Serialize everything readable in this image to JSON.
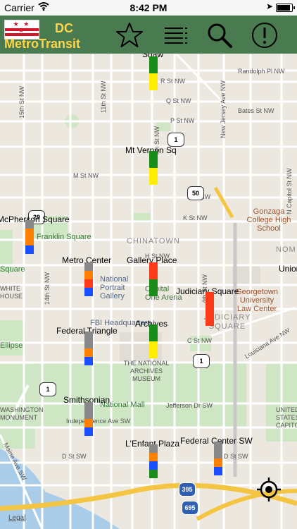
{
  "status": {
    "carrier": "Carrier",
    "time": "8:42 PM"
  },
  "header": {
    "title_line1": "DC",
    "title_line2": "MetroTransit"
  },
  "icons": {
    "favorites": "star-icon",
    "list": "list-icon",
    "search": "search-icon",
    "alerts": "exclamation-icon",
    "locate": "locate-icon"
  },
  "map": {
    "legal": "Legal",
    "streets": {
      "randolph": "Randolph Pl NW",
      "r_st": "R St NW",
      "q_st": "Q St NW",
      "bates": "Bates St NW",
      "p_st": "P St NW",
      "m_st": "M St NW",
      "l_st": "L St NW",
      "k_st": "K St NW",
      "h_st": "H St NW",
      "c_st": "C St NW",
      "jefferson": "Jefferson Dr SW",
      "independence": "Independence Ave SW",
      "d_st_sw": "D St SW",
      "d_st_sw2": "D St SW",
      "louisiana": "Louisiana Ave NW",
      "nj_ave": "New Jersey Ave NW",
      "n_capitol": "N Capitol St NW",
      "fourth": "4th St NW",
      "seventh": "7th St NW",
      "eleventh": "11th St NW",
      "fourteenth": "14th St NW",
      "fifteenth": "15th St NW",
      "maine": "Maine Ave SW"
    },
    "pois": {
      "gonzaga": "Gonzaga College High School",
      "franklin": "Franklin Square",
      "national_gallery": "National Portrait Gallery",
      "capital_one": "Capital One Arena",
      "georgetown": "Georgetown University Law Center",
      "fbi": "FBI Headquarters",
      "archives_museum": "THE NATIONAL ARCHIVES MUSEUM",
      "national_mall": "National Mall",
      "washington_monument": "WASHINGTON MONUMENT",
      "us_capitol": "UNITED STATES CAPITOL",
      "ellipse": "Ellipse",
      "union": "Union",
      "white_house": "WHITE HOUSE",
      "square": "Square"
    },
    "areas": {
      "chinatown": "CHINATOWN",
      "judiciary": "JUDICIARY SQUARE",
      "noma": "NOM"
    },
    "highways": {
      "us1_a": "1",
      "us1_b": "1",
      "us1_c": "1",
      "us50": "50",
      "us29": "29",
      "i395": "395",
      "i695": "695"
    }
  },
  "stations": [
    {
      "name": "Shaw",
      "segments": [
        "#1a8c1a",
        "#1a8c1a",
        "#ffee00",
        "#ffee00"
      ]
    },
    {
      "name": "Mt Vernon Sq",
      "segments": [
        "#1a8c1a",
        "#1a8c1a",
        "#ffee00",
        "#ffee00"
      ]
    },
    {
      "name": "McPherson Square",
      "segments": [
        "#888888",
        "#ff7f00",
        "#ff7f00",
        "#1a4fff"
      ]
    },
    {
      "name": "Metro Center",
      "segments": [
        "#888888",
        "#ff7f00",
        "#ff3a1a",
        "#1a4fff"
      ]
    },
    {
      "name": "Gallery Place",
      "segments": [
        "#ff3a1a",
        "#ff3a1a",
        "#1a8c1a",
        "#1a8c1a"
      ]
    },
    {
      "name": "Judiciary Square",
      "segments": [
        "#ff3a1a",
        "#ff3a1a",
        "#ff3a1a",
        "#ff3a1a"
      ]
    },
    {
      "name": "Archives",
      "segments": [
        "#1a8c1a",
        "#1a8c1a",
        "#ffee00",
        "#ffee00"
      ]
    },
    {
      "name": "Federal Triangle",
      "segments": [
        "#888888",
        "#888888",
        "#ff7f00",
        "#1a4fff"
      ]
    },
    {
      "name": "Smithsonian",
      "segments": [
        "#888888",
        "#888888",
        "#ff7f00",
        "#1a4fff"
      ]
    },
    {
      "name": "L'Enfant Plaza",
      "segments": [
        "#888888",
        "#ff7f00",
        "#1a4fff",
        "#1a8c1a"
      ]
    },
    {
      "name": "Federal Center SW",
      "segments": [
        "#888888",
        "#888888",
        "#ff7f00",
        "#1a4fff"
      ]
    }
  ]
}
